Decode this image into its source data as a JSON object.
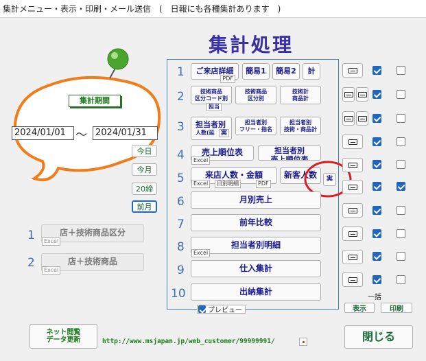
{
  "window": {
    "title": "集計メニュー・表示・印刷・メール送信　(　日報にも各種集計あります　)"
  },
  "heading": "集計処理",
  "period": {
    "label": "集計期間",
    "date_from": "2024/01/01",
    "separator": "〜",
    "date_to": "2024/01/31",
    "quick_buttons": [
      "今日",
      "今月",
      "20締",
      "前月"
    ]
  },
  "left_menu": [
    {
      "num": "1",
      "label": "店＋技術商品区分",
      "tag": "Excel"
    },
    {
      "num": "2",
      "label": "店＋技術商品",
      "tag": "Excel"
    }
  ],
  "rows": {
    "r1": {
      "num": "1",
      "b1": "ご来店詳細",
      "b1_tag": "PDF",
      "b2": "簡易1",
      "b3": "簡易2",
      "b4": "計"
    },
    "r2": {
      "num": "2",
      "b1": "技術商品\n区分コード別",
      "b1_tag": "担当",
      "b2": "技術商品\n区分別",
      "b3": "技術計\n商品計"
    },
    "r3": {
      "num": "3",
      "b1": "担当者別",
      "b1_sub": "人数(延",
      "b1_tag": "実",
      "b2": "担当者別\nフリー・指名",
      "b3": "担当者別\n技術・商品計"
    },
    "r4": {
      "num": "4",
      "b1": "売上順位表",
      "b1_tag": "Excel",
      "b2": "担当者別\n売上順位表"
    },
    "r5": {
      "num": "5",
      "b1": "来店人数・金額",
      "b1_tag1": "Excel",
      "b1_tag2": "日別明細",
      "b1_tag3": "PDF",
      "b2": "新客人数",
      "b3": "実"
    },
    "r6": {
      "num": "6",
      "b1": "月別売上"
    },
    "r7": {
      "num": "7",
      "b1": "前年比較"
    },
    "r8": {
      "num": "8",
      "b1": "担当者別明細",
      "b1_tag": "Excel"
    },
    "r9": {
      "num": "9",
      "b1": "仕入集計"
    },
    "r10": {
      "num": "10",
      "b1": "出納集計"
    }
  },
  "preview": {
    "label": "プレビュー",
    "checked": true
  },
  "batch": {
    "label": "一括",
    "show": "表示",
    "print": "印刷"
  },
  "checks": {
    "blue": [
      true,
      true,
      true,
      true,
      true,
      true,
      true,
      true,
      true,
      true
    ],
    "right": [
      false,
      false,
      false,
      false,
      false,
      true,
      false,
      false,
      false,
      false
    ]
  },
  "footer": {
    "net_button": "ネット閲覧\nデータ更新",
    "url": "http://www.msjapan.jp/web_customer/99999991/",
    "close": "閉じる"
  },
  "colors": {
    "accent": "#3d6fb5",
    "heading": "#3a2fa3",
    "blob": "#f07d1a",
    "pin": "#4aa52e",
    "annotation": "#d81e1e"
  }
}
